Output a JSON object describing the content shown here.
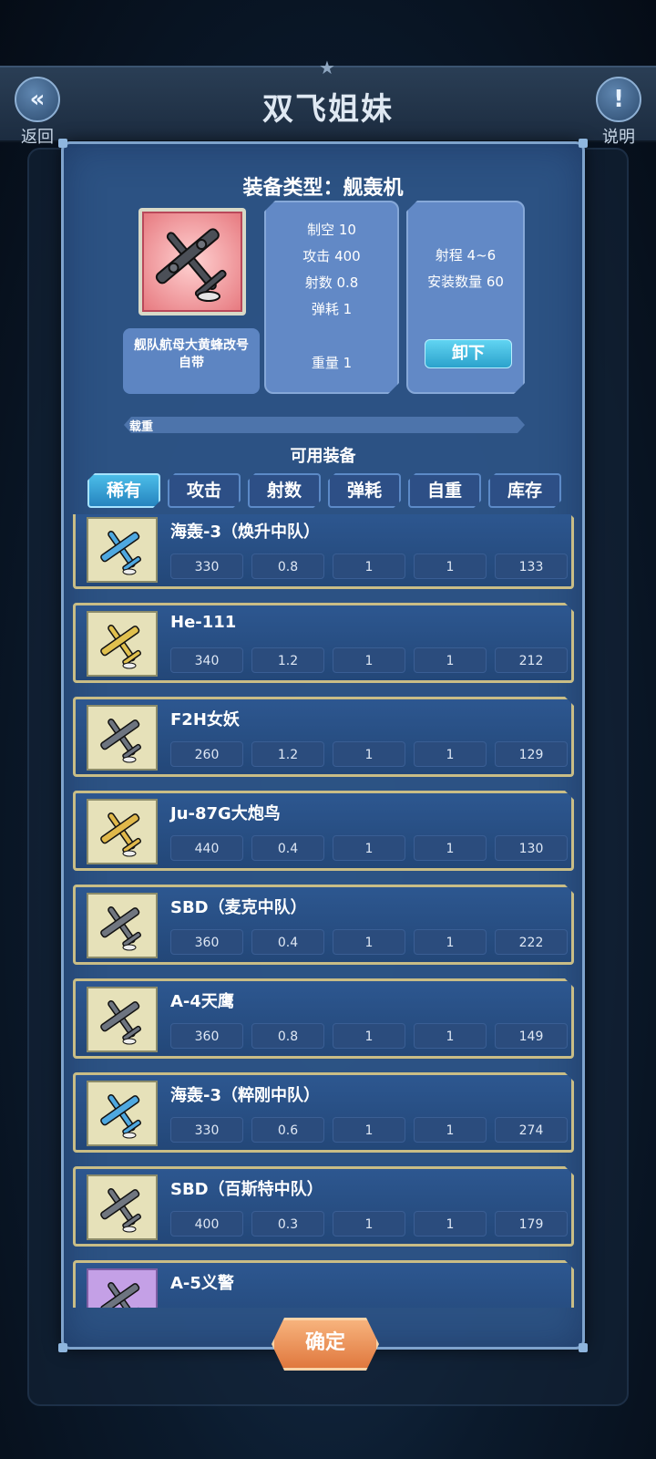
{
  "header": {
    "title": "双飞姐妹",
    "back_label": "返回",
    "help_label": "说明"
  },
  "equip": {
    "type_title": "装备类型：舰轰机",
    "source": "舰队航母大黄蜂改号自带",
    "stats_mid": [
      "制空 10",
      "攻击 400",
      "射数 0.8",
      "弹耗 1"
    ],
    "weight": "重量 1",
    "stats_right": [
      "射程 4~6",
      "安装数量 60"
    ],
    "unload_label": "卸下"
  },
  "load": {
    "label": "载重",
    "fraction": 0.0
  },
  "available_title": "可用装备",
  "tabs": [
    "稀有",
    "攻击",
    "射数",
    "弹耗",
    "自重",
    "库存"
  ],
  "items": [
    {
      "name": "海轰-3（焕升中队）",
      "values": [
        "330",
        "0.8",
        "1",
        "1",
        "133"
      ],
      "thumb": "blue-plane-icon",
      "rarity": "yellow"
    },
    {
      "name": "He-111",
      "values": [
        "340",
        "1.2",
        "1",
        "1",
        "212"
      ],
      "thumb": "yellow-bomber-icon",
      "rarity": "yellow"
    },
    {
      "name": "F2H女妖",
      "values": [
        "260",
        "1.2",
        "1",
        "1",
        "129"
      ],
      "thumb": "grey-jet-icon",
      "rarity": "yellow"
    },
    {
      "name": "Ju-87G大炮鸟",
      "values": [
        "440",
        "0.4",
        "1",
        "1",
        "130"
      ],
      "thumb": "yellow-plane-icon",
      "rarity": "yellow"
    },
    {
      "name": "SBD（麦克中队）",
      "values": [
        "360",
        "0.4",
        "1",
        "1",
        "222"
      ],
      "thumb": "striped-plane-icon",
      "rarity": "yellow"
    },
    {
      "name": "A-4天鹰",
      "values": [
        "360",
        "0.8",
        "1",
        "1",
        "149"
      ],
      "thumb": "grey-jet-icon",
      "rarity": "yellow"
    },
    {
      "name": "海轰-3（粹刚中队）",
      "values": [
        "330",
        "0.6",
        "1",
        "1",
        "274"
      ],
      "thumb": "blue-plane-icon",
      "rarity": "yellow"
    },
    {
      "name": "SBD（百斯特中队）",
      "values": [
        "400",
        "0.3",
        "1",
        "1",
        "179"
      ],
      "thumb": "striped-plane-icon",
      "rarity": "yellow"
    },
    {
      "name": "A-5义警",
      "values": [
        "",
        "",
        "",
        "",
        ""
      ],
      "thumb": "grey-jet-icon",
      "rarity": "purple"
    }
  ],
  "confirm_label": "确定",
  "colors": {
    "accent": "#4bbde8",
    "confirm": "#e0783e",
    "frame": "#c9bd86"
  }
}
